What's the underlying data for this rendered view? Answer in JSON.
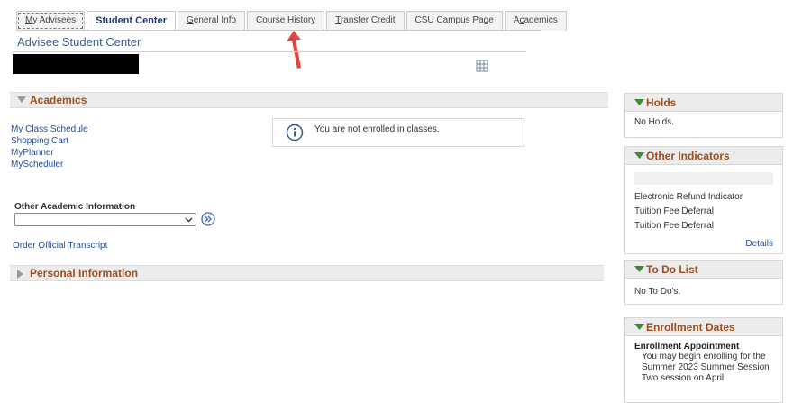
{
  "tabs": [
    {
      "label": "My Advisees",
      "ul": "M",
      "rest": "y Advisees"
    },
    {
      "label": "Student Center"
    },
    {
      "label": "General Info",
      "ul": "G",
      "rest": "eneral Info"
    },
    {
      "label": "Course History"
    },
    {
      "label": "Transfer Credit",
      "ul": "T",
      "rest": "ransfer Credit"
    },
    {
      "label": "CSU Campus Page"
    },
    {
      "label": "Academics",
      "pre": "A",
      "ul": "c",
      "rest": "ademics"
    }
  ],
  "page": {
    "title": "Advisee Student Center"
  },
  "academics": {
    "header": "Academics",
    "links": [
      "My Class Schedule",
      "Shopping Cart",
      "MyPlanner",
      "MyScheduler"
    ],
    "notice": "You are not enrolled in classes.",
    "other_label": "Other Academic Information",
    "select_value": "",
    "transcript_link": "Order Official Transcript"
  },
  "personal": {
    "header": "Personal Information"
  },
  "holds": {
    "header": "Holds",
    "text": "No Holds."
  },
  "indicators": {
    "header": "Other Indicators",
    "items": [
      "Electronic Refund Indicator",
      "Tuition Fee Deferral",
      "Tuition Fee Deferral"
    ],
    "details": "Details"
  },
  "todo": {
    "header": "To Do List",
    "text": "No To Do's."
  },
  "enrollment": {
    "header": "Enrollment Dates",
    "sub": "Enrollment Appointment",
    "text": "You may begin enrolling for the Summer 2023 Summer Session Two session on April"
  },
  "colors": {
    "accent": "#a14d1c",
    "link": "#1f4e9c",
    "title": "#3b5f8a",
    "arrow": "#e0453f"
  }
}
